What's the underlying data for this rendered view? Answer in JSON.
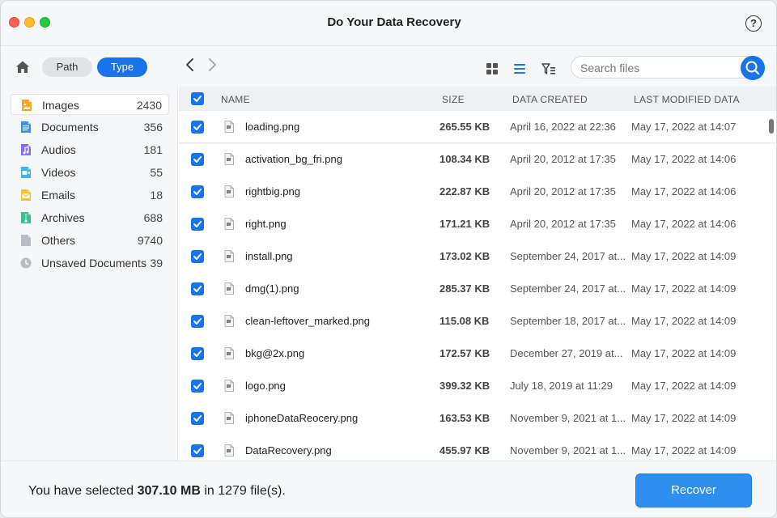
{
  "window": {
    "title": "Do Your Data Recovery",
    "help_label": "?"
  },
  "toolbar": {
    "path_label": "Path",
    "type_label": "Type",
    "search_placeholder": "Search files"
  },
  "sidebar": {
    "items": [
      {
        "label": "Images",
        "count": "2430",
        "icon": "image-icon",
        "color": "#f5a623"
      },
      {
        "label": "Documents",
        "count": "356",
        "icon": "document-icon",
        "color": "#3d8ef0"
      },
      {
        "label": "Audios",
        "count": "181",
        "icon": "audio-icon",
        "color": "#8b6cf0"
      },
      {
        "label": "Videos",
        "count": "55",
        "icon": "video-icon",
        "color": "#38b6e8"
      },
      {
        "label": "Emails",
        "count": "18",
        "icon": "email-icon",
        "color": "#f4c430"
      },
      {
        "label": "Archives",
        "count": "688",
        "icon": "archive-icon",
        "color": "#3cbf8a"
      },
      {
        "label": "Others",
        "count": "9740",
        "icon": "file-icon",
        "color": "#b8bcc4"
      },
      {
        "label": "Unsaved Documents",
        "count": "39",
        "icon": "clock-icon",
        "color": "#b8bcc4"
      }
    ]
  },
  "table": {
    "headers": {
      "name": "NAME",
      "size": "SIZE",
      "created": "DATA CREATED",
      "modified": "LAST MODIFIED DATA"
    },
    "rows": [
      {
        "name": "loading.png",
        "size": "265.55 KB",
        "created": "April 16, 2022 at 22:36",
        "modified": "May 17, 2022 at 14:07"
      },
      {
        "name": "activation_bg_fri.png",
        "size": "108.34 KB",
        "created": "April 20, 2012 at 17:35",
        "modified": "May 17, 2022 at 14:06"
      },
      {
        "name": "rightbig.png",
        "size": "222.87 KB",
        "created": "April 20, 2012 at 17:35",
        "modified": "May 17, 2022 at 14:06"
      },
      {
        "name": "right.png",
        "size": "171.21 KB",
        "created": "April 20, 2012 at 17:35",
        "modified": "May 17, 2022 at 14:06"
      },
      {
        "name": "install.png",
        "size": "173.02 KB",
        "created": "September 24, 2017 at...",
        "modified": "May 17, 2022 at 14:09"
      },
      {
        "name": "dmg(1).png",
        "size": "285.37 KB",
        "created": "September 24, 2017 at...",
        "modified": "May 17, 2022 at 14:09"
      },
      {
        "name": "clean-leftover_marked.png",
        "size": "115.08 KB",
        "created": "September 18, 2017 at...",
        "modified": "May 17, 2022 at 14:09"
      },
      {
        "name": "bkg@2x.png",
        "size": "172.57 KB",
        "created": "December 27, 2019 at...",
        "modified": "May 17, 2022 at 14:09"
      },
      {
        "name": "logo.png",
        "size": "399.32 KB",
        "created": "July 18, 2019 at 11:29",
        "modified": "May 17, 2022 at 14:09"
      },
      {
        "name": "iphoneDataReocery.png",
        "size": "163.53 KB",
        "created": "November 9, 2021 at 1...",
        "modified": "May 17, 2022 at 14:09"
      },
      {
        "name": "DataRecovery.png",
        "size": "455.97 KB",
        "created": "November 9, 2021 at 1...",
        "modified": "May 17, 2022 at 14:09"
      }
    ]
  },
  "footer": {
    "status_prefix": "You have selected ",
    "selected_size": "307.10 MB",
    "status_suffix": " in 1279 file(s).",
    "recover_label": "Recover"
  },
  "colors": {
    "accent": "#1a73e8",
    "recover": "#2f8ff0"
  }
}
